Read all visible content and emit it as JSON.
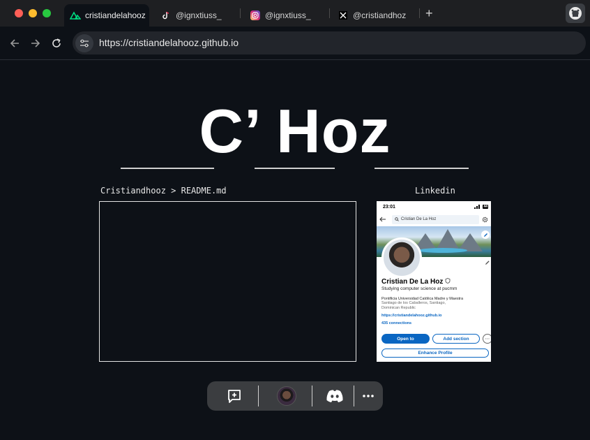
{
  "browser": {
    "tabs": [
      {
        "label": "cristiandelahooz",
        "icon": "nuxt-icon",
        "active": true
      },
      {
        "label": "@ignxtiuss_",
        "icon": "tiktok-icon",
        "active": false
      },
      {
        "label": "@ignxtiuss_",
        "icon": "instagram-icon",
        "active": false
      },
      {
        "label": "@cristiandhoz",
        "icon": "x-icon",
        "active": false
      }
    ],
    "new_tab_label": "+",
    "url": "https://cristiandelahooz.github.io",
    "extension_icon": "github-icon"
  },
  "page": {
    "hero_title": "C’ Hoz",
    "readme_label": "Cristiandhooz > README.md",
    "linkedin_label": "Linkedin"
  },
  "linkedin_card": {
    "time": "23:01",
    "battery": "44",
    "search_text": "Cristian De La Hoz",
    "name": "Cristian De La Hoz",
    "headline": "Studying computer science at pucmm",
    "school": "Pontificia Universidad Católica Madre y Maestra",
    "location_line1": "Santiago de los Caballeros, Santiago,",
    "location_line2": "Dominican Republic",
    "link": "https://cristiandelahooz.github.io",
    "connections": "435 connections",
    "open_to": "Open to",
    "add_section": "Add section",
    "more": "···",
    "enhance": "Enhance Profile"
  },
  "dock": {
    "items": [
      "add-comment-icon",
      "avatar",
      "discord-icon",
      "more-icon"
    ]
  },
  "colors": {
    "page_bg": "#0d1117",
    "titlebar_bg": "#1e1f22",
    "linkedin_blue": "#0a66c2",
    "dock_bg": "#3b3d40"
  }
}
